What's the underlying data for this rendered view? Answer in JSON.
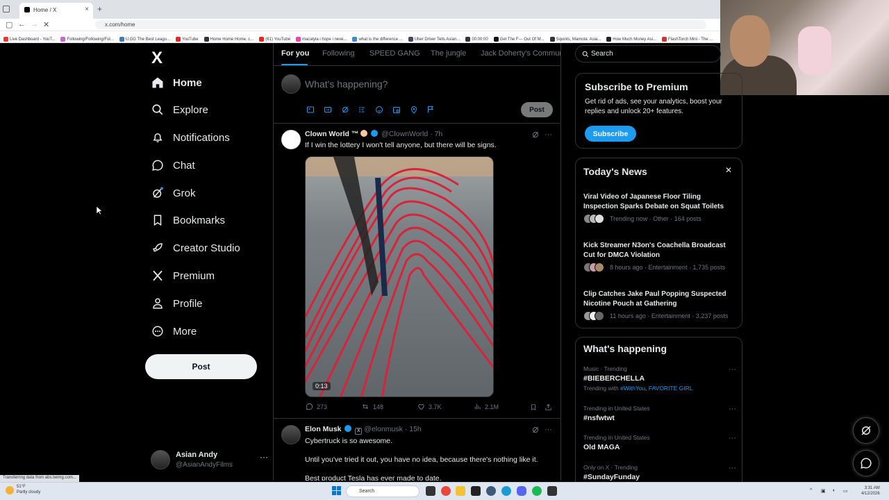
{
  "browser": {
    "tab_title": "Home / X",
    "tab_close": "×",
    "new_tab": "+",
    "url": "x.com/home",
    "bookmarks": [
      "Live Dashboard - YouT...",
      "Following/Following/Fol...",
      "U.GG The Best Leagu...",
      "YouTube",
      "Home Home Home, c...",
      "(61) YouTube",
      "macalyla i hope i neve...",
      "what is the difference ...",
      "Uber Driver Tells Asian...",
      "00:00:00",
      "Get The F--- Out Of M...",
      "Squints, Mamota: Asia...",
      "How Much Money Asi...",
      "FlashTorch Mini - The ..."
    ],
    "status_text": "Transferring data from abs.twimg.com..."
  },
  "sidebar": {
    "logo": "X",
    "items": [
      {
        "label": "Home",
        "icon": "home-icon"
      },
      {
        "label": "Explore",
        "icon": "search-icon"
      },
      {
        "label": "Notifications",
        "icon": "bell-icon"
      },
      {
        "label": "Chat",
        "icon": "chat-icon"
      },
      {
        "label": "Grok",
        "icon": "grok-icon"
      },
      {
        "label": "Bookmarks",
        "icon": "bookmark-icon"
      },
      {
        "label": "Creator Studio",
        "icon": "rocket-icon"
      },
      {
        "label": "Premium",
        "icon": "x-icon"
      },
      {
        "label": "Profile",
        "icon": "person-icon"
      },
      {
        "label": "More",
        "icon": "more-circle-icon"
      }
    ],
    "post_label": "Post",
    "account": {
      "name": "Asian Andy",
      "handle": "@AsianAndyFilms",
      "more": "···"
    }
  },
  "feed": {
    "tabs": [
      "For you",
      "Following",
      "SPEED GANG",
      "The jungle",
      "Jack Doherty's Commun"
    ],
    "compose_placeholder": "What's happening?",
    "compose_post": "Post",
    "tweets": [
      {
        "name": "Clown World ™",
        "handle": "@ClownWorld",
        "time": "· 7h",
        "text": "If I win the lottery I won't tell anyone, but there will be signs.",
        "video_duration": "0:13",
        "replies": "273",
        "reposts": "148",
        "likes": "3.7K",
        "views": "2.1M"
      },
      {
        "name": "Elon Musk",
        "handle": "@elonmusk",
        "time": "· 15h",
        "text1": "Cybertruck is so awesome.",
        "text2": "Until you've tried it out, you have no idea, because there's nothing like it.",
        "text3": "Best product Tesla has ever made to date."
      }
    ]
  },
  "right": {
    "search_placeholder": "Search",
    "premium": {
      "title": "Subscribe to Premium",
      "body": "Get rid of ads, see your analytics, boost your replies and unlock 20+ features.",
      "button": "Subscribe"
    },
    "news": {
      "title": "Today's News",
      "close": "✕",
      "items": [
        {
          "title": "Viral Video of Japanese Floor Tiling Inspection Sparks Debate on Squat Toilets",
          "meta": "Trending now · Other · 164 posts"
        },
        {
          "title": "Kick Streamer N3on's Coachella Broadcast Cut for DMCA Violation",
          "meta": "8 hours ago · Entertainment · 1,735 posts"
        },
        {
          "title": "Clip Catches Jake Paul Popping Suspected Nicotine Pouch at Gathering",
          "meta": "11 hours ago · Entertainment · 3,237 posts"
        }
      ]
    },
    "happening": {
      "title": "What's happening",
      "trends": [
        {
          "context": "Music · Trending",
          "name": "#BIEBERCHELLA",
          "with_prefix": "Trending with",
          "with": "#WithYou, FAVORITE GIRL"
        },
        {
          "context": "Trending in United States",
          "name": "#nsfwtwt"
        },
        {
          "context": "Trending in United States",
          "name": "Old MAGA"
        },
        {
          "context": "Only on X · Trending",
          "name": "#SundayFunday"
        }
      ],
      "more": "···"
    }
  },
  "taskbar": {
    "weather_temp": "51°F",
    "weather_desc": "Partly cloudy",
    "search": "Search",
    "time": "3:31 AM",
    "date": "4/12/2026"
  }
}
